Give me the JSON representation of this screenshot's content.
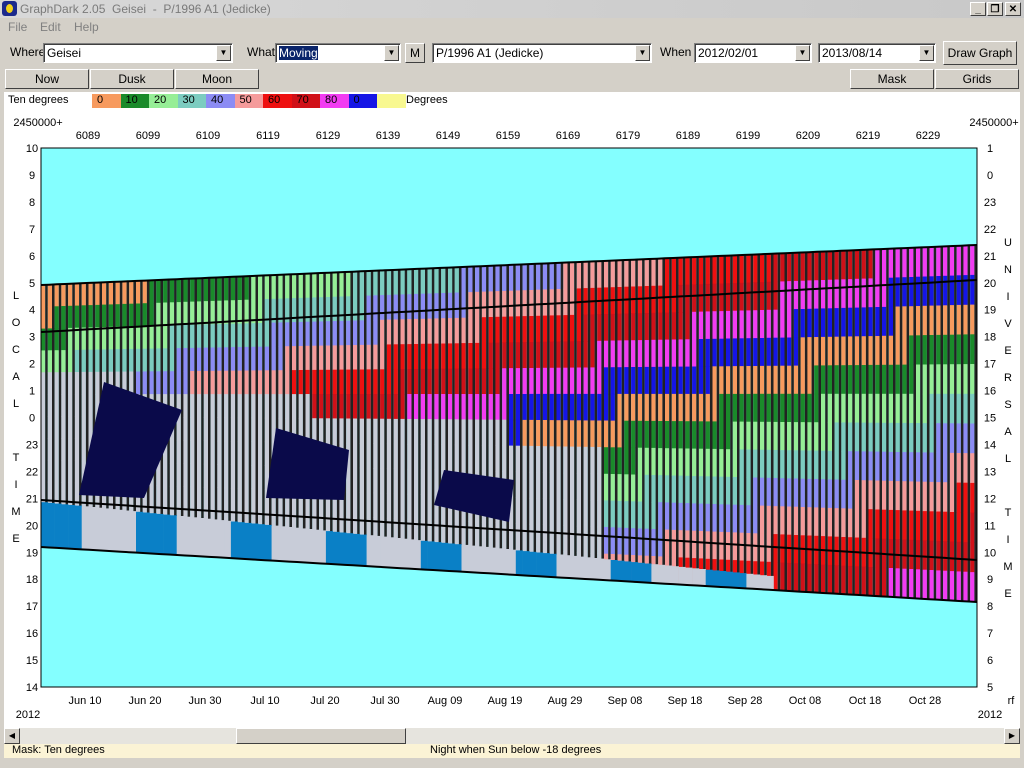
{
  "window": {
    "title": "GraphDark 2.05  Geisei  -  P/1996 A1 (Jedicke)"
  },
  "menu": [
    "File",
    "Edit",
    "Help"
  ],
  "toolbar": {
    "where_label": "Where",
    "where_value": "Geisei",
    "what_label": "What",
    "what_value": "Moving",
    "m_button": "M",
    "object_value": "P/1996 A1 (Jedicke)",
    "when_label": "When",
    "start_date": "2012/02/01",
    "end_date": "2013/08/14",
    "draw_button": "Draw Graph"
  },
  "row2": {
    "now": "Now",
    "dusk": "Dusk",
    "moon": "Moon",
    "mask": "Mask",
    "grids": "Grids"
  },
  "legend": {
    "label": "Ten degrees",
    "unit": "Degrees",
    "items": [
      {
        "label": "0",
        "color": "#f79a5e"
      },
      {
        "label": "10",
        "color": "#1a8a2a"
      },
      {
        "label": "20",
        "color": "#96ee96"
      },
      {
        "label": "30",
        "color": "#7cccc0"
      },
      {
        "label": "40",
        "color": "#8c8cf4"
      },
      {
        "label": "50",
        "color": "#f59b9b"
      },
      {
        "label": "60",
        "color": "#ee1010"
      },
      {
        "label": "70",
        "color": "#d01018"
      },
      {
        "label": "80",
        "color": "#f23cf2"
      },
      {
        "label": "0",
        "color": "#1515e6"
      },
      {
        "label": "",
        "color": "#f8f890"
      }
    ]
  },
  "chart_data": {
    "type": "heatmap",
    "top_axis_prefix_left": "2450000+",
    "top_axis_prefix_right": "2450000+",
    "jd_ticks": [
      "6089",
      "6099",
      "6109",
      "6119",
      "6129",
      "6139",
      "6149",
      "6159",
      "6169",
      "6179",
      "6189",
      "6199",
      "6209",
      "6219",
      "6229"
    ],
    "bottom_ticks": [
      "Jun 10",
      "Jun 20",
      "Jun 30",
      "Jul 10",
      "Jul 20",
      "Jul 30",
      "Aug 09",
      "Aug 19",
      "Aug 29",
      "Sep 08",
      "Sep 18",
      "Sep 28",
      "Oct 08",
      "Oct 18",
      "Oct 28"
    ],
    "year_left": "2012",
    "year_right": "2012",
    "right_corner": "rf",
    "left_ticks": [
      "10",
      "9",
      "8",
      "7",
      "6",
      "5",
      "4",
      "3",
      "2",
      "1",
      "0",
      "23",
      "22",
      "21",
      "20",
      "19",
      "18",
      "17",
      "16",
      "15",
      "14"
    ],
    "right_ticks": [
      "1",
      "0",
      "23",
      "22",
      "21",
      "20",
      "19",
      "18",
      "17",
      "16",
      "15",
      "14",
      "13",
      "12",
      "11",
      "10",
      "9",
      "8",
      "7",
      "6",
      "5"
    ],
    "left_axis_letters": [
      "L",
      "O",
      "C",
      "A",
      "L",
      "",
      "T",
      "I",
      "M",
      "E"
    ],
    "right_axis_letters": [
      "U",
      "N",
      "I",
      "V",
      "E",
      "R",
      "S",
      "A",
      "L",
      "",
      "T",
      "I",
      "M",
      "E"
    ],
    "background_color": "#84ffff",
    "night_color": "#0a0a4a",
    "twilight_color": "#0a80c6",
    "moon_color": "#c8ccd8"
  },
  "status": {
    "mask": "Mask:  Ten degrees",
    "night": "Night when Sun below -18 degrees"
  }
}
